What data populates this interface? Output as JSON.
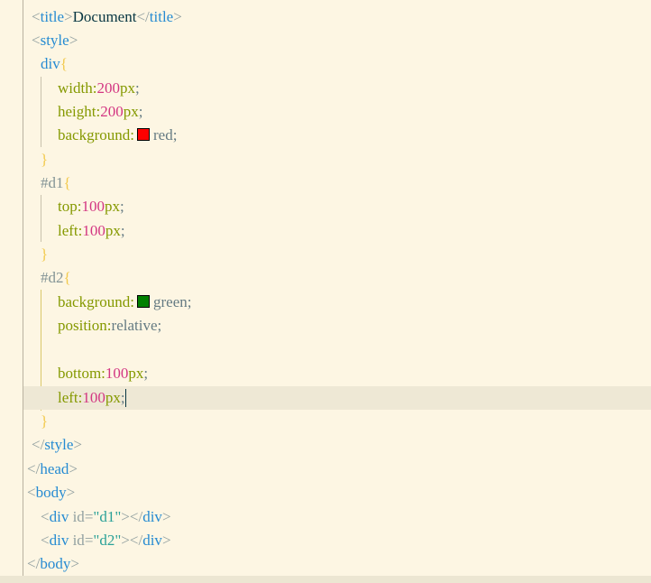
{
  "colors": {
    "red_swatch": "#ff0000",
    "green_swatch": "#008000"
  },
  "lines": {
    "l1": {
      "open": "<",
      "tag": "title",
      "close": ">",
      "text": "Document",
      "end_open": "</",
      "end_tag": "title",
      "end_close": ">"
    },
    "l2": {
      "open": "<",
      "tag": "style",
      "close": ">"
    },
    "l3": {
      "selector": "div",
      "brace": "{"
    },
    "l4": {
      "prop": "width",
      "colon": ":",
      "num": "200",
      "unit": "px",
      "semi": ";"
    },
    "l5": {
      "prop": "height",
      "colon": ":",
      "num": "200",
      "unit": "px",
      "semi": ";"
    },
    "l6": {
      "prop": "background",
      "colon": ":",
      "value": "red",
      "semi": ";"
    },
    "l7": {
      "brace": "}"
    },
    "l8": {
      "selector": "#d1",
      "brace": "{"
    },
    "l9": {
      "prop": "top",
      "colon": ":",
      "num": "100",
      "unit": "px",
      "semi": ";"
    },
    "l10": {
      "prop": "left",
      "colon": ":",
      "num": "100",
      "unit": "px",
      "semi": ";"
    },
    "l11": {
      "brace": "}"
    },
    "l12": {
      "selector": "#d2",
      "brace": "{"
    },
    "l13": {
      "prop": "background",
      "colon": ":",
      "value": "green",
      "semi": ";"
    },
    "l14": {
      "prop": "position",
      "colon": ":",
      "value": "relative",
      "semi": ";"
    },
    "l16": {
      "prop": "bottom",
      "colon": ":",
      "num": "100",
      "unit": "px",
      "semi": ";"
    },
    "l17": {
      "prop": "left",
      "colon": ":",
      "num": "100",
      "unit": "px",
      "semi": ";"
    },
    "l18": {
      "brace": "}"
    },
    "l19": {
      "open": "</",
      "tag": "style",
      "close": ">"
    },
    "l20": {
      "open": "</",
      "tag": "head",
      "close": ">"
    },
    "l21": {
      "open": "<",
      "tag": "body",
      "close": ">"
    },
    "l22": {
      "open": "<",
      "tag": "div",
      "attr": " id",
      "eq": "=",
      "str": "\"d1\"",
      "close": ">",
      "end_open": "</",
      "end_tag": "div",
      "end_close": ">"
    },
    "l23": {
      "open": "<",
      "tag": "div",
      "attr": " id",
      "eq": "=",
      "str": "\"d2\"",
      "close": ">",
      "end_open": "</",
      "end_tag": "div",
      "end_close": ">"
    },
    "l24": {
      "open": "</",
      "tag": "body",
      "close": ">"
    }
  }
}
